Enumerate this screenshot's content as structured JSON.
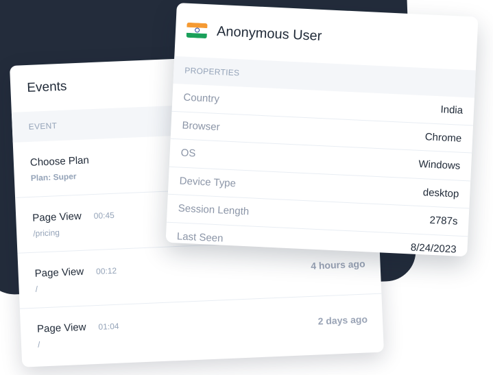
{
  "events": {
    "title": "Events",
    "column_header": "EVENT",
    "rows": [
      {
        "name": "Choose Plan",
        "duration": "",
        "detail": "Plan: Super",
        "ago": ""
      },
      {
        "name": "Page View",
        "duration": "00:45",
        "detail": "/pricing",
        "ago": ""
      },
      {
        "name": "Page View",
        "duration": "00:12",
        "detail": "/",
        "ago": "4 hours ago"
      },
      {
        "name": "Page View",
        "duration": "01:04",
        "detail": "/",
        "ago": "2 days ago"
      }
    ]
  },
  "user": {
    "flag_icon": "india-flag-icon",
    "name": "Anonymous User",
    "properties_header": "PROPERTIES",
    "properties": [
      {
        "key": "Country",
        "value": "India"
      },
      {
        "key": "Browser",
        "value": "Chrome"
      },
      {
        "key": "OS",
        "value": "Windows"
      },
      {
        "key": "Device Type",
        "value": "desktop"
      },
      {
        "key": "Session Length",
        "value": "2787s"
      },
      {
        "key": "Last Seen",
        "value": "8/24/2023"
      }
    ]
  },
  "colors": {
    "dark_background": "#232c3b",
    "header_background": "#f4f6f9",
    "muted_text": "#94a3b8",
    "primary_text": "#1f2937"
  }
}
